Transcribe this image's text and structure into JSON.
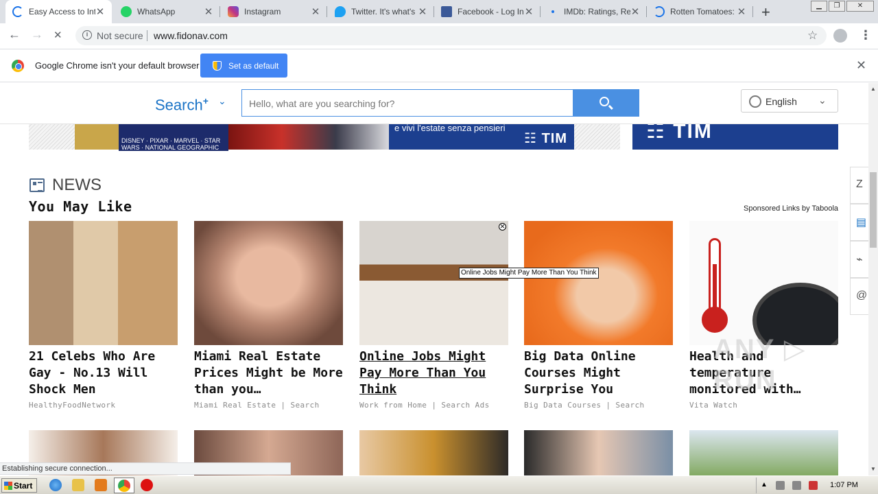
{
  "tabs": [
    {
      "title": "Easy Access to Inte",
      "favicon": "loading-spinner-icon",
      "color": "#1a73e8",
      "active": true
    },
    {
      "title": "WhatsApp",
      "favicon": "whatsapp-icon",
      "color": "#25d366",
      "active": false
    },
    {
      "title": "Instagram",
      "favicon": "instagram-icon",
      "color": "#c13584",
      "active": false
    },
    {
      "title": "Twitter. It's what's",
      "favicon": "twitter-icon",
      "color": "#1da1f2",
      "active": false
    },
    {
      "title": "Facebook - Log In o",
      "favicon": "facebook-icon",
      "color": "#3b5998",
      "active": false
    },
    {
      "title": "IMDb: Ratings, Rev",
      "favicon": "imdb-icon",
      "color": "#1a73e8",
      "active": false
    },
    {
      "title": "Rotten Tomatoes: M",
      "favicon": "loading-spinner-icon",
      "color": "#1a73e8",
      "active": false
    }
  ],
  "tab_close_glyph": "✕",
  "new_tab_glyph": "+",
  "window_controls": {
    "minimize": "▁",
    "restore": "❐",
    "close": "✕"
  },
  "address_bar": {
    "security_label": "Not secure",
    "url": "www.fidonav.com",
    "info_glyph": "i"
  },
  "nav_glyphs": {
    "back": "←",
    "forward": "→",
    "stop": "✕",
    "star": "☆",
    "menu": "⋮"
  },
  "infobar": {
    "message": "Google Chrome isn't your default browser",
    "button_label": "Set as default",
    "close_glyph": "✕"
  },
  "site_header": {
    "logo_text": "Search",
    "logo_sup": "+",
    "logo_chevron": "⌄",
    "search_placeholder": "Hello, what are you searching for?",
    "language": "English",
    "language_chevron": "⌄"
  },
  "banner": {
    "tim_tagline": "e vivi l'estate senza pensieri",
    "tim_logo": "☷ TIM",
    "tim_logo_right": "☷ TIM",
    "brands_text": "DISNEY · PIXAR · MARVEL · STAR WARS · NATIONAL GEOGRAPHIC"
  },
  "news": {
    "section_title": "NEWS",
    "subtitle": "You May Like",
    "sponsored": "Sponsored Links by Taboola",
    "cards": [
      {
        "title": "21 Celebs Who Are Gay - No.13 Will Shock Men",
        "source": "HealthyFoodNetwork",
        "underlined": false
      },
      {
        "title": "Miami Real Estate Prices Might be More than you…",
        "source": "Miami Real Estate | Search",
        "underlined": false
      },
      {
        "title": "Online Jobs Might Pay More Than You Think",
        "source": "Work from Home | Search Ads",
        "underlined": true
      },
      {
        "title": "Big Data Online Courses Might Surprise You",
        "source": "Big Data Courses | Search",
        "underlined": false
      },
      {
        "title": "Health and temperature monitored with…",
        "source": "Vita Watch",
        "underlined": false
      }
    ],
    "tooltip": "Online Jobs Might Pay More Than You Think",
    "ad_close_glyph": "✕"
  },
  "side_buttons": [
    "Z",
    "▤",
    "⌁",
    "@"
  ],
  "status_text": "Establishing secure connection...",
  "watermark": "ANY ▷ RUN",
  "taskbar": {
    "start_label": "Start",
    "clock": "1:07 PM"
  }
}
